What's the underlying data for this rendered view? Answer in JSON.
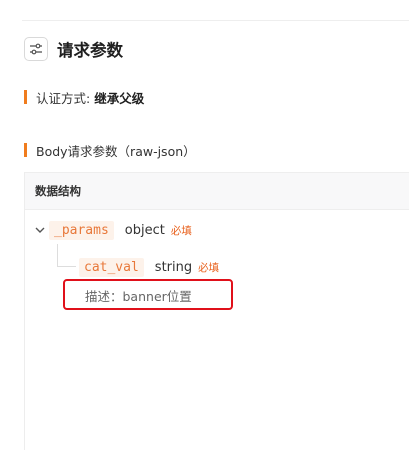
{
  "section": {
    "title": "请求参数",
    "icon": "settings-sliders-icon"
  },
  "auth": {
    "label": "认证方式:",
    "value": "继承父级"
  },
  "body_params": {
    "label": "Body请求参数（raw-json）"
  },
  "table": {
    "header": "数据结构"
  },
  "fields": [
    {
      "name": "_params",
      "type": "object",
      "required": "必填",
      "expanded": true
    },
    {
      "name": "cat_val",
      "type": "string",
      "required": "必填",
      "description": "描述：banner位置"
    }
  ],
  "colors": {
    "accent": "#f07c1e",
    "field_name": "#e8783a",
    "required": "#e8601c",
    "highlight": "#e0101a"
  }
}
